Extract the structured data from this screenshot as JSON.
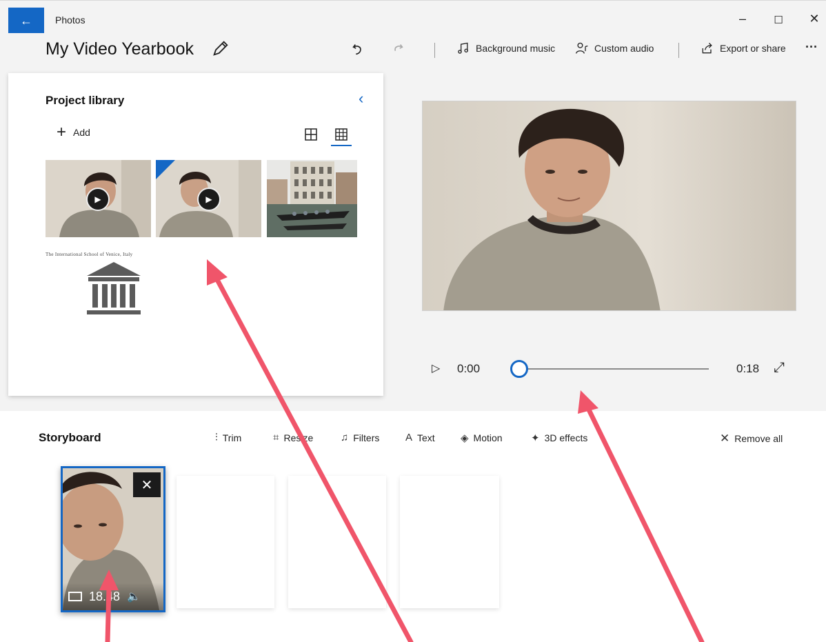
{
  "window": {
    "app_title": "Photos",
    "back_icon": "arrow-left-icon",
    "minimize": "–",
    "maximize": "☐",
    "close": "✕"
  },
  "project": {
    "title": "My Video Yearbook",
    "edit_icon": "pencil-icon"
  },
  "toolbar": {
    "undo_icon": "undo-icon",
    "redo_icon": "redo-icon",
    "background_music": "Background music",
    "custom_audio": "Custom audio",
    "export_share": "Export or share",
    "more": "···"
  },
  "library": {
    "title": "Project library",
    "collapse": "‹",
    "add_label": "Add",
    "items": [
      {
        "kind": "video",
        "label": "video-clip-boy-1"
      },
      {
        "kind": "video",
        "label": "video-clip-boy-2"
      },
      {
        "kind": "photo",
        "label": "venice-canal-photo"
      },
      {
        "kind": "logo",
        "caption": "The International School of Venice, Italy"
      }
    ]
  },
  "player": {
    "play": "▷",
    "current_time": "0:00",
    "total_time": "0:18",
    "progress": 0,
    "expand": "⤢"
  },
  "storyboard": {
    "title": "Storyboard",
    "tools": [
      {
        "icon": "trim-icon",
        "glyph": "⫶",
        "label": "Trim"
      },
      {
        "icon": "resize-icon",
        "glyph": "⌗",
        "label": "Resize"
      },
      {
        "icon": "filters-icon",
        "glyph": "♫",
        "label": "Filters"
      },
      {
        "icon": "text-icon",
        "glyph": "A",
        "label": "Text"
      },
      {
        "icon": "motion-icon",
        "glyph": "◈",
        "label": "Motion"
      },
      {
        "icon": "3d-effects-icon",
        "glyph": "✦",
        "label": "3D effects"
      }
    ],
    "remove_all": "Remove all",
    "clip": {
      "duration": "18.48",
      "close": "✕"
    }
  },
  "colors": {
    "accent": "#1467c5",
    "annotation_arrow": "#f0556a"
  }
}
